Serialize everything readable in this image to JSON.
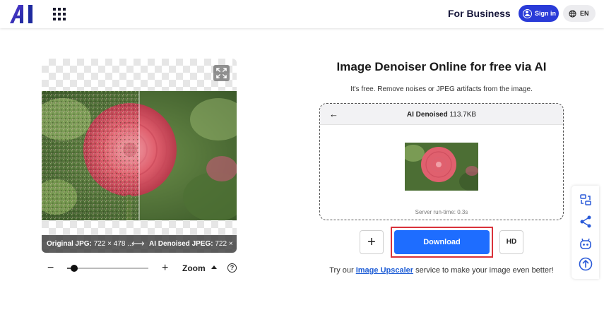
{
  "header": {
    "logo_text": "AI",
    "for_business": "For Business",
    "signin_label": "Sign in",
    "lang_label": "EN"
  },
  "preview": {
    "original_label": "Original JPG:",
    "original_dims": "722 × 478 ...",
    "denoised_label": "AI Denoised JPEG:",
    "denoised_dims": "722 × ...",
    "compare_arrow": "⟷"
  },
  "zoom": {
    "minus": "−",
    "plus": "+",
    "label": "Zoom",
    "help": "?",
    "level": 0.09
  },
  "main": {
    "title": "Image Denoiser Online for free via AI",
    "subtitle": "It's free. Remove noises or JPEG artifacts from the image.",
    "result": {
      "back_arrow": "←",
      "title": "AI Denoised",
      "size": "113.7KB",
      "runtime": "Server run-time: 0.3s"
    },
    "add_label": "+",
    "download_label": "Download",
    "hd_label": "HD",
    "try_prefix": "Try our ",
    "try_link": "Image Upscaler",
    "try_suffix": " service to make your image even better!"
  },
  "colors": {
    "brand": "#2a3bd8",
    "download": "#1e6dff",
    "highlight": "#d9323a",
    "link": "#1e5dd6"
  },
  "icons": [
    "apps-grid-icon",
    "globe-icon",
    "expand-icon",
    "swap-icon",
    "share-icon",
    "robot-icon",
    "arrow-up-icon"
  ]
}
